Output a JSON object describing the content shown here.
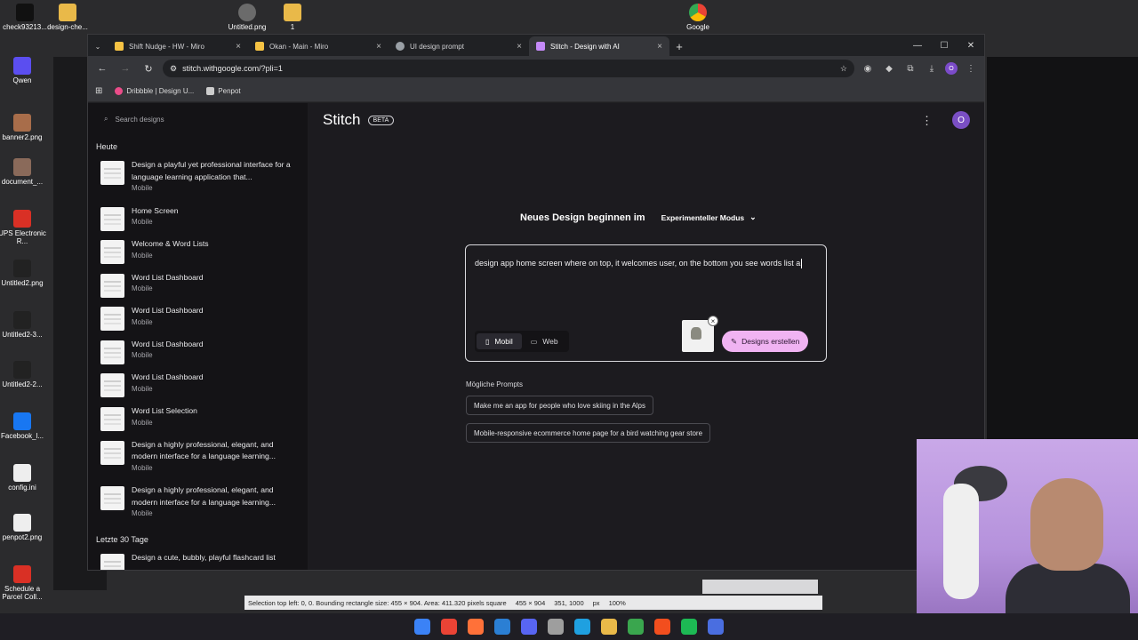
{
  "desktop": {
    "icons": [
      {
        "label": "check93213...",
        "color": "#111111"
      },
      {
        "label": "design-che...",
        "color": "#e9b949"
      },
      {
        "label": "Untitled.png",
        "color": "#6b6b6b"
      },
      {
        "label": "1",
        "color": "#e9b949"
      },
      {
        "label": "Google",
        "color": "#4285f4"
      },
      {
        "label": "Qwen",
        "color": "#5b4ef0"
      },
      {
        "label": "banner2.png",
        "color": "#a86d4a"
      },
      {
        "label": "document_...",
        "color": "#8a6a5a"
      },
      {
        "label": "UPS Electronic R...",
        "color": "#d93025"
      },
      {
        "label": "Untitled2.png",
        "color": "#222222"
      },
      {
        "label": "Untitled2-3...",
        "color": "#222222"
      },
      {
        "label": "Untitled2-2...",
        "color": "#222222"
      },
      {
        "label": "Facebook_l...",
        "color": "#1877f2"
      },
      {
        "label": "config.ini",
        "color": "#eeeeee"
      },
      {
        "label": "penpot2.png",
        "color": "#eeeeee"
      },
      {
        "label": "Schedule a Parcel Coll...",
        "color": "#d93025"
      }
    ]
  },
  "browser": {
    "tabs": [
      {
        "title": "Shift Nudge - HW - Miro",
        "color": "#f6c344",
        "active": false
      },
      {
        "title": "Okan - Main - Miro",
        "color": "#f6c344",
        "active": false
      },
      {
        "title": "UI design prompt",
        "color": "#9aa0a6",
        "active": false
      },
      {
        "title": "Stitch - Design with AI",
        "color": "#c58af9",
        "active": true
      }
    ],
    "url": "stitch.withgoogle.com/?pli=1",
    "profile_initial": "O",
    "bookmarks": [
      {
        "label": "Dribbble | Design U...",
        "color": "#ea4c89"
      },
      {
        "label": "Penpot",
        "color": "#cccccc"
      }
    ]
  },
  "sidebar": {
    "search_placeholder": "Search designs",
    "today_label": "Heute",
    "items": [
      {
        "title": "Design a playful yet professional interface for a language learning application that...",
        "sub": "Mobile",
        "tall": true
      },
      {
        "title": "Home Screen",
        "sub": "Mobile",
        "tall": false
      },
      {
        "title": "Welcome & Word Lists",
        "sub": "Mobile",
        "tall": false
      },
      {
        "title": "Word List Dashboard",
        "sub": "Mobile",
        "tall": false
      },
      {
        "title": "Word List Dashboard",
        "sub": "Mobile",
        "tall": false
      },
      {
        "title": "Word List Dashboard",
        "sub": "Mobile",
        "tall": false
      },
      {
        "title": "Word List Dashboard",
        "sub": "Mobile",
        "tall": false
      },
      {
        "title": "Word List Selection",
        "sub": "Mobile",
        "tall": false
      },
      {
        "title": "Design a highly professional, elegant, and modern interface for a language learning...",
        "sub": "Mobile",
        "tall": true
      },
      {
        "title": "Design a highly professional, elegant, and modern interface for a language learning...",
        "sub": "Mobile",
        "tall": true
      }
    ],
    "last30_label": "Letzte 30 Tage",
    "last30_first": "Design a cute, bubbly, playful flashcard list"
  },
  "stitch": {
    "brand": "Stitch",
    "beta": "BETA",
    "avatar_initial": "O",
    "headline": "Neues Design beginnen im",
    "mode": "Experimenteller Modus",
    "prompt_text": "design app home screen where on top, it welcomes user, on the bottom you see words list a",
    "device_mobile": "Mobil",
    "device_web": "Web",
    "create_label": "Designs erstellen",
    "prompts_label": "Mögliche Prompts",
    "suggestions": [
      "Make me an app for people who love skiing in the Alps",
      "Mobile-responsive ecommerce home page for a bird watching gear store"
    ]
  },
  "editor_status": {
    "selection": "Selection top left: 0, 0. Bounding rectangle size: 455 × 904. Area: 411.320 pixels square",
    "size": "455 × 904",
    "coords": "351, 1000",
    "unit": "px",
    "zoom": "100%"
  },
  "taskbar": {
    "apps": [
      "start",
      "chrome",
      "firefox",
      "vscode",
      "discord",
      "obs",
      "edge",
      "explorer",
      "terminal",
      "figma",
      "spotify",
      "snipping"
    ],
    "colors": [
      "#3b82f6",
      "#ea4335",
      "#ff7139",
      "#2b7fd4",
      "#5865f2",
      "#9e9e9e",
      "#1fa0e0",
      "#e9b949",
      "#3aa64e",
      "#f24e1e",
      "#1db954",
      "#4a6ee0"
    ]
  }
}
